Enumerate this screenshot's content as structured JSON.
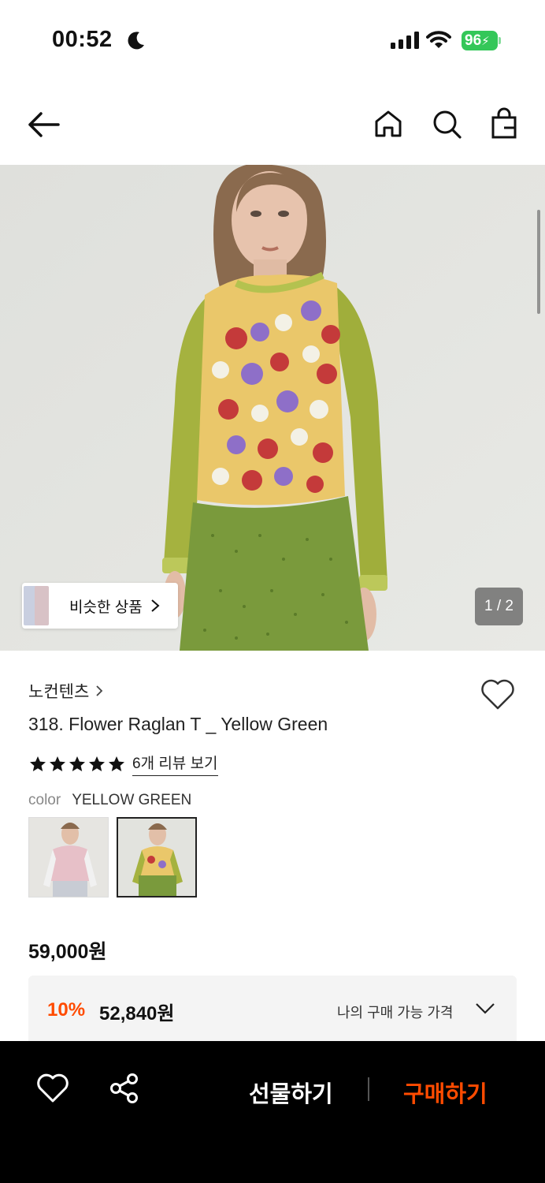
{
  "status_bar": {
    "time": "00:52",
    "battery": "96"
  },
  "nav": {
    "back_icon": "arrow-left-icon",
    "home_icon": "home-icon",
    "search_icon": "search-icon",
    "bag_icon": "shopping-bag-icon"
  },
  "hero": {
    "similar_label": "비슷한 상품",
    "pager": "1 / 2"
  },
  "product": {
    "brand": "노컨텐츠",
    "title": "318. Flower Raglan T _ Yellow Green",
    "rating_stars": 5,
    "reviews_link": "6개 리뷰 보기",
    "color_label": "color",
    "color_value": "YELLOW GREEN",
    "price": "59,000원",
    "discount_percent": "10%",
    "sale_price": "52,840원",
    "my_price_label": "나의 구매 가능 가격"
  },
  "bottom_bar": {
    "gift_label": "선물하기",
    "buy_label": "구매하기"
  },
  "colors": {
    "accent": "#ff4b00",
    "battery": "#34c759",
    "bottom_bar": "#000000"
  }
}
